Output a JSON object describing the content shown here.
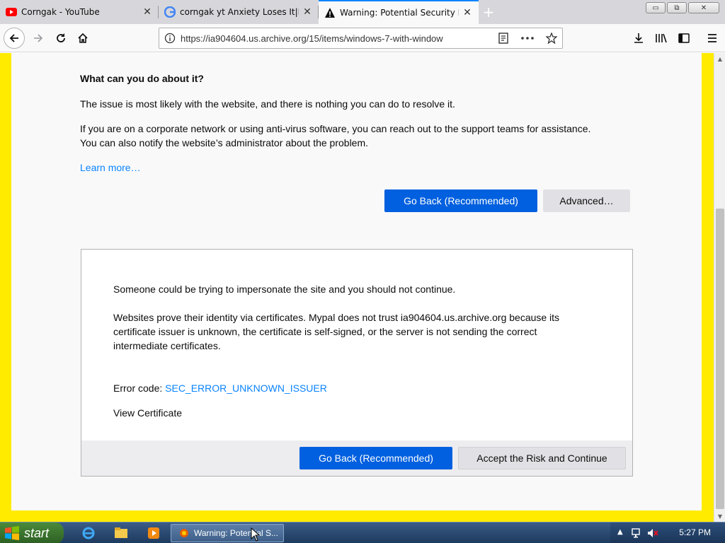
{
  "tabs": [
    {
      "title": "Corngak - YouTube",
      "favicon": "youtube-icon",
      "active": false
    },
    {
      "title": "corngak yt Anxiety Loses It|Ins",
      "favicon": "google-icon",
      "active": false
    },
    {
      "title": "Warning: Potential Security Ris",
      "favicon": "warning-icon",
      "active": true
    }
  ],
  "new_tab": "+",
  "window_controls": {
    "minimize": "▭",
    "maximize": "⧉",
    "close": "✕"
  },
  "navbar": {
    "url": "https://ia904604.us.archive.org/15/items/windows-7-with-window"
  },
  "page": {
    "heading": "What can you do about it?",
    "para1": "The issue is most likely with the website, and there is nothing you can do to resolve it.",
    "para2_line1": "If you are on a corporate network or using anti-virus software, you can reach out to the support teams for assistance.",
    "para2_line2": "You can also notify the website’s administrator about the problem.",
    "learn_more": "Learn more…",
    "go_back_label": "Go Back (Recommended)",
    "advanced_label": "Advanced…"
  },
  "advanced": {
    "line1": "Someone could be trying to impersonate the site and you should not continue.",
    "line2": "Websites prove their identity via certificates. Mypal does not trust ia904604.us.archive.org because its",
    "line3": "certificate issuer is unknown, the certificate is self-signed, or the server is not sending the correct",
    "line4": "intermediate certificates.",
    "error_code_label": "Error code: ",
    "error_code": "SEC_ERROR_UNKNOWN_ISSUER",
    "view_certificate": "View Certificate",
    "go_back_label": "Go Back (Recommended)",
    "accept_label": "Accept the Risk and Continue"
  },
  "taskbar": {
    "start_label": "start",
    "task_item": "Warning: Potential S...",
    "clock": "5:27 PM"
  },
  "colors": {
    "accent": "#0060df",
    "link": "#0a84ff",
    "warning_border": "#ffeb00"
  }
}
